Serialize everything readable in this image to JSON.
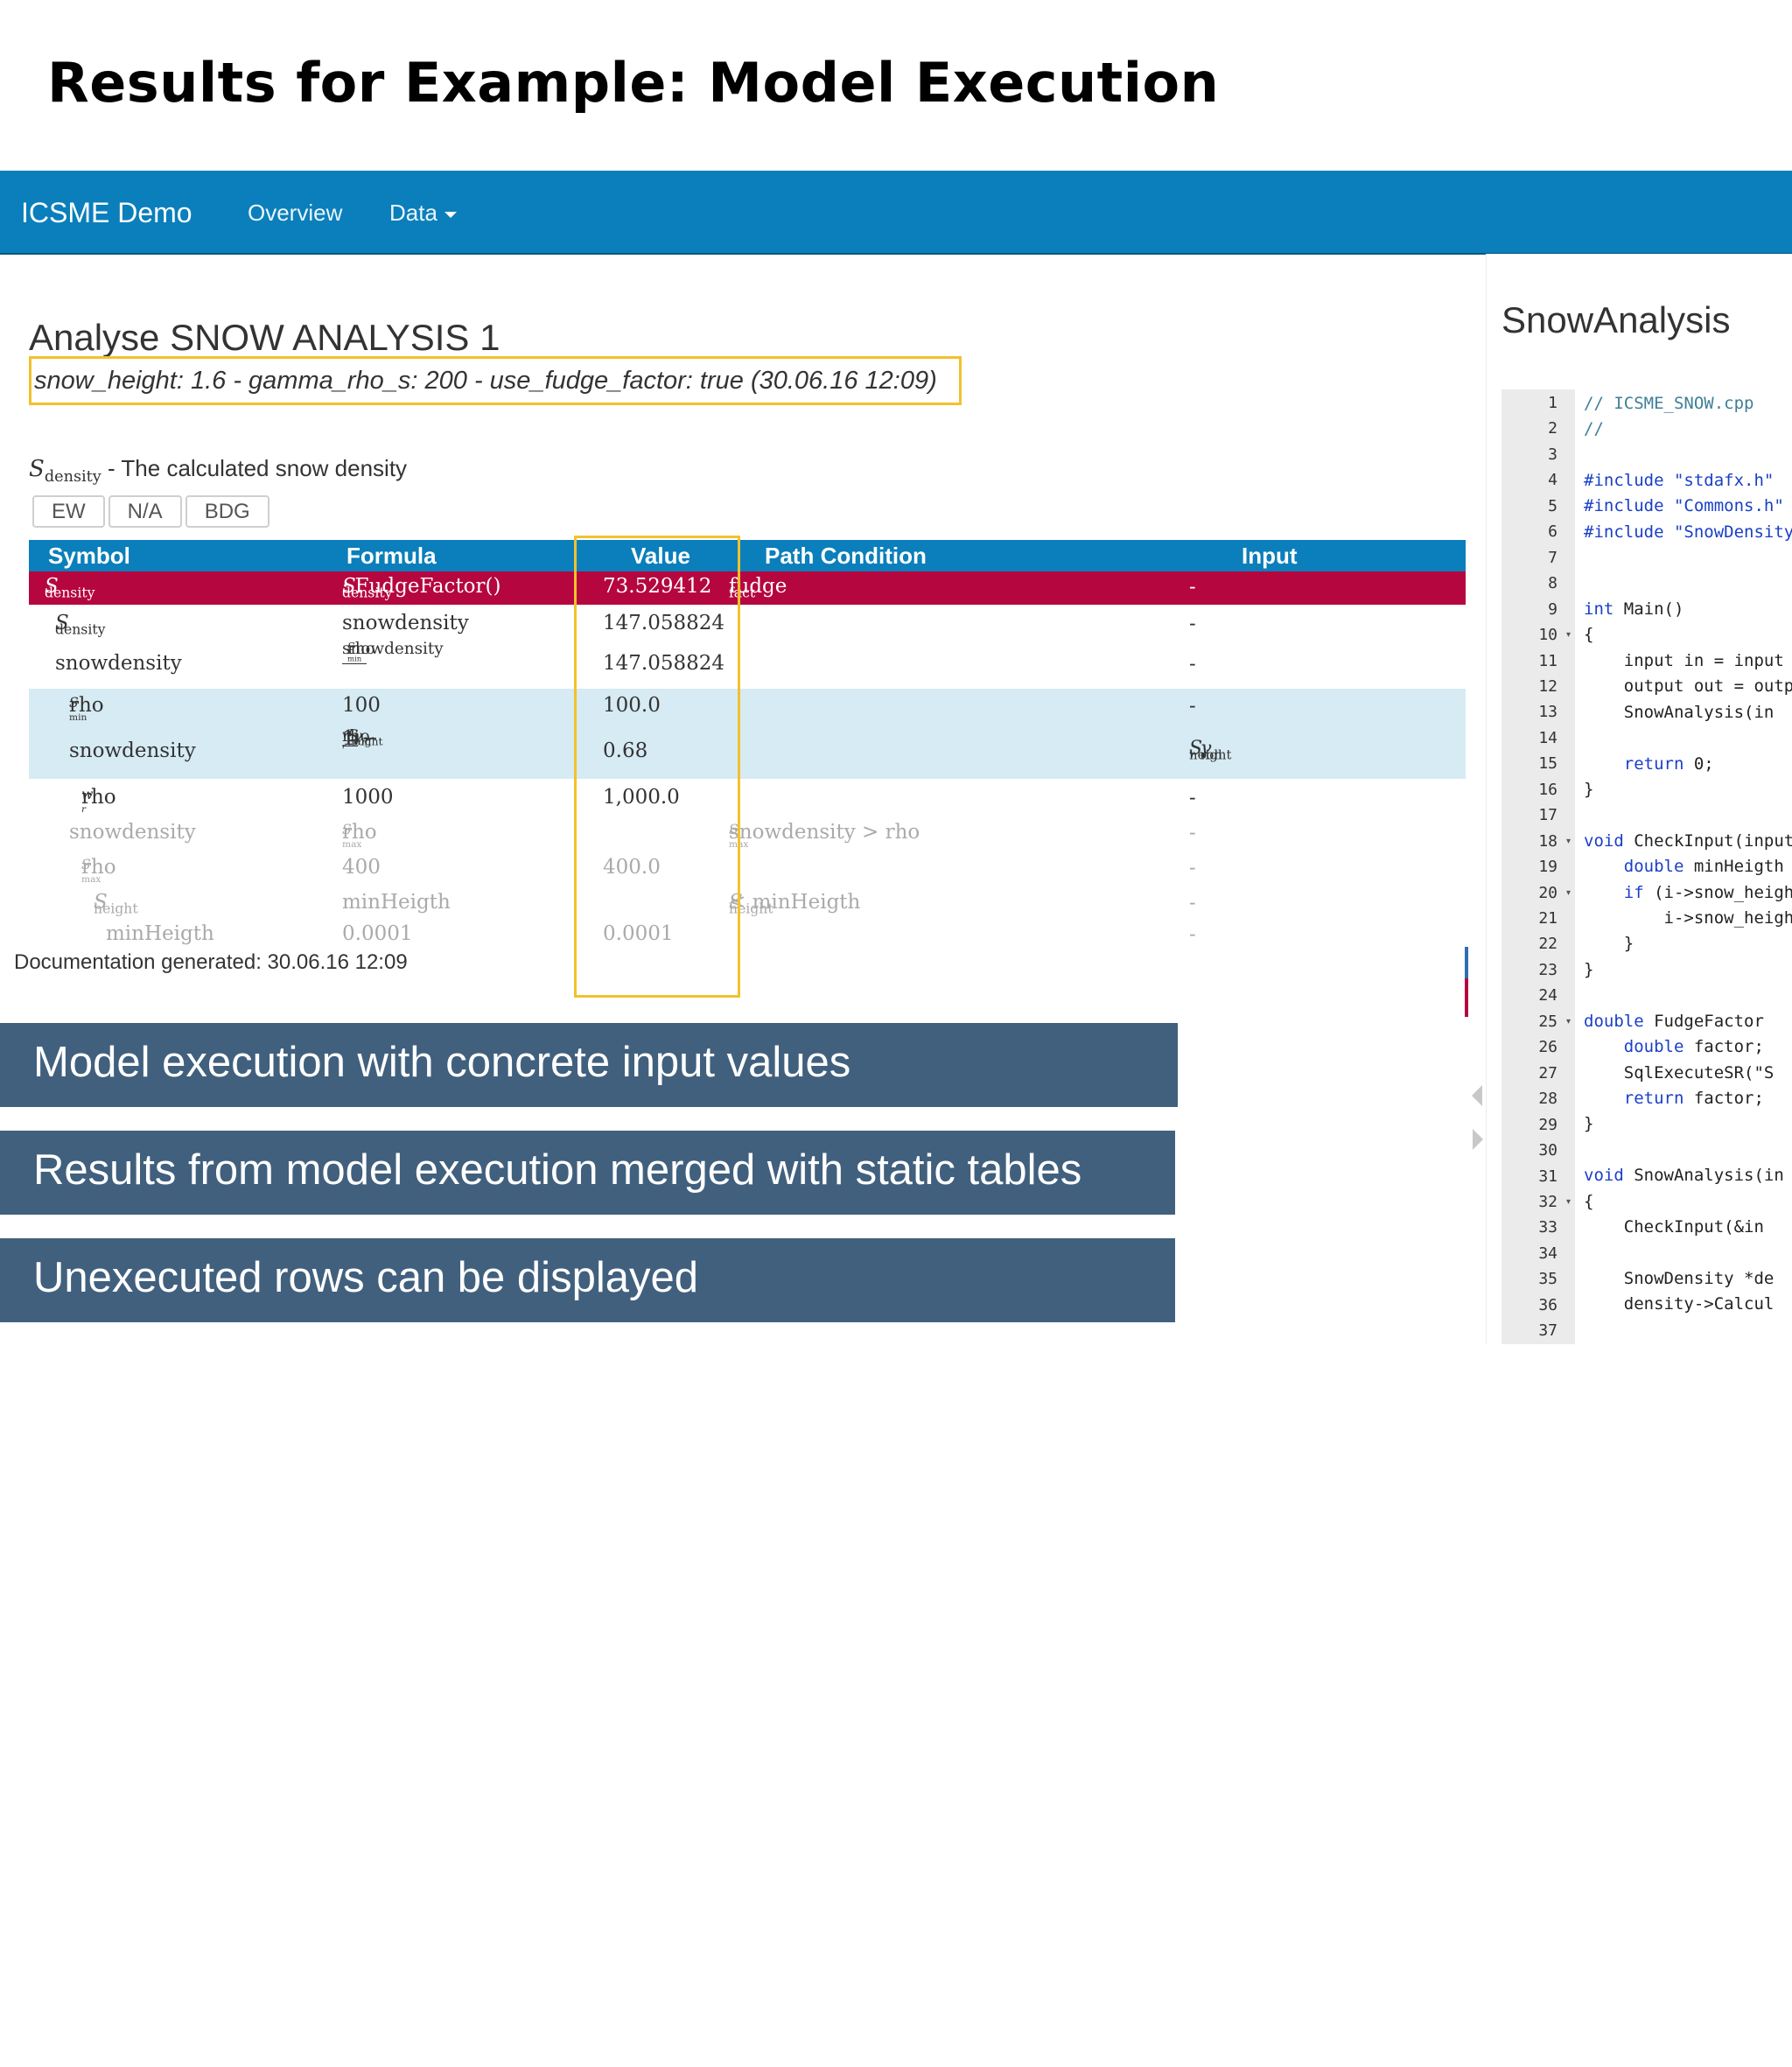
{
  "slide": {
    "title": "Results for Example: Model Execution"
  },
  "navbar": {
    "brand": "ICSME Demo",
    "items": [
      "Overview",
      "Data"
    ]
  },
  "analysis": {
    "title": "Analyse SNOW ANALYSIS 1",
    "params": "snow_height: 1.6 - gamma_rho_s: 200 - use_fudge_factor: true (30.06.16 12:09)",
    "variable_sym": "S",
    "variable_sub": "density",
    "variable_desc": " - The calculated snow density",
    "units": [
      "EW",
      "N/A",
      "BDG"
    ]
  },
  "table": {
    "headers": [
      "Symbol",
      "Formula",
      "Value",
      "Path Condition",
      "Input"
    ],
    "rows": {
      "r1": {
        "sym": "S",
        "sub": "density",
        "formula_sym": "S",
        "formula_sub": "density",
        "formula_rest": " · FudgeFactor()",
        "value": "73.529412",
        "path": "fudge",
        "path_sub": "fact",
        "input": "-"
      },
      "r2": {
        "sym": "S",
        "sub": "density",
        "formula": "snowdensity",
        "value": "147.058824",
        "input": "-"
      },
      "r3": {
        "sym": "snowdensity",
        "num": "rho",
        "num_sub": "S",
        "num_subsub": "min",
        "den": "snowdensity",
        "value": "147.058824",
        "input": "-"
      },
      "r4": {
        "sym": "rho",
        "sub": "S",
        "subsub": "min",
        "formula": "100",
        "value": "100.0",
        "input": "-"
      },
      "r5": {
        "sym": "snowdensity",
        "formula_pre": "1 − ",
        "num_a": "S",
        "num_a_sub": "height",
        "num_b": "γ",
        "num_b_sub": "roh",
        "den": "rho",
        "den_sub": "w",
        "den_subsub": "r",
        "value": "0.68",
        "input_a": "S",
        "input_a_sub": "height",
        "input_b": "γ",
        "input_b_sub": "roh"
      },
      "r6": {
        "sym": "rho",
        "sub": "w",
        "subsub": "r",
        "formula": "1000",
        "value": "1,000.0",
        "input": "-"
      },
      "r7": {
        "sym": "snowdensity",
        "formula": "rho",
        "formula_sub": "S",
        "formula_subsub": "max",
        "path": "snowdensity > rho",
        "path_sub": "S",
        "path_subsub": "max",
        "input": "-"
      },
      "r8": {
        "sym": "rho",
        "sub": "S",
        "subsub": "max",
        "formula": "400",
        "value": "400.0",
        "input": "-"
      },
      "r9": {
        "sym": "S",
        "sub": "height",
        "formula": "minHeigth",
        "path_sym": "S",
        "path_sub": "height",
        "path_rest": " < minHeigth",
        "input": "-"
      },
      "r10": {
        "sym": "minHeigth",
        "formula": "0.0001",
        "value": "0.0001",
        "input": "-"
      }
    }
  },
  "doc_generated": "Documentation generated: 30.06.16 12:09",
  "banners": [
    "Model execution with concrete input values",
    "Results from model execution merged with static tables",
    "Unexecuted rows can be displayed"
  ],
  "code_panel": {
    "title": "SnowAnalysis",
    "line_numbers": [
      "1",
      "2",
      "3",
      "4",
      "5",
      "6",
      "7",
      "8",
      "9",
      "10",
      "11",
      "12",
      "13",
      "14",
      "15",
      "16",
      "17",
      "18",
      "19",
      "20",
      "21",
      "22",
      "23",
      "24",
      "25",
      "26",
      "27",
      "28",
      "29",
      "30",
      "31",
      "32",
      "33",
      "34",
      "35",
      "36",
      "37"
    ],
    "fold_icon": "fold-arrow-icon",
    "lines": {
      "l1": "// ICSME_SNOW.cpp",
      "l2": "//",
      "l4": "#include \"stdafx.h\"",
      "l5": "#include \"Commons.h\"",
      "l6": "#include \"SnowDensity.h\"",
      "l9_kw": "int",
      "l9_rest": " Main()",
      "l10": "{",
      "l11": "    input in = input",
      "l12": "    output out = output",
      "l13": "    SnowAnalysis(in",
      "l15_kw": "    return",
      "l15_rest": " 0;",
      "l16": "}",
      "l18_kw": "void",
      "l18_rest": " CheckInput(input",
      "l19_kw": "    double",
      "l19_rest": " minHeigth",
      "l20_kw": "    if",
      "l20_rest": " (i->snow_height",
      "l21": "        i->snow_height",
      "l22": "    }",
      "l23": "}",
      "l25_kw": "double",
      "l25_rest": " FudgeFactor",
      "l26_kw": "    double",
      "l26_rest": " factor;",
      "l27": "    SqlExecuteSR(\"S",
      "l28_kw": "    return",
      "l28_rest": " factor;",
      "l29": "}",
      "l31_kw": "void",
      "l31_rest": " SnowAnalysis(in",
      "l32": "{",
      "l33": "    CheckInput(&in",
      "l35": "    SnowDensity *de",
      "l36": "    density->Calcul"
    }
  },
  "colors": {
    "navbar": "#0a7fbb",
    "highlight_row": "#b5063f",
    "input_rows": "#d6ebf3",
    "highlight_box": "#f2c12e",
    "banner": "#41607e",
    "keyword": "#1a3fc6"
  }
}
